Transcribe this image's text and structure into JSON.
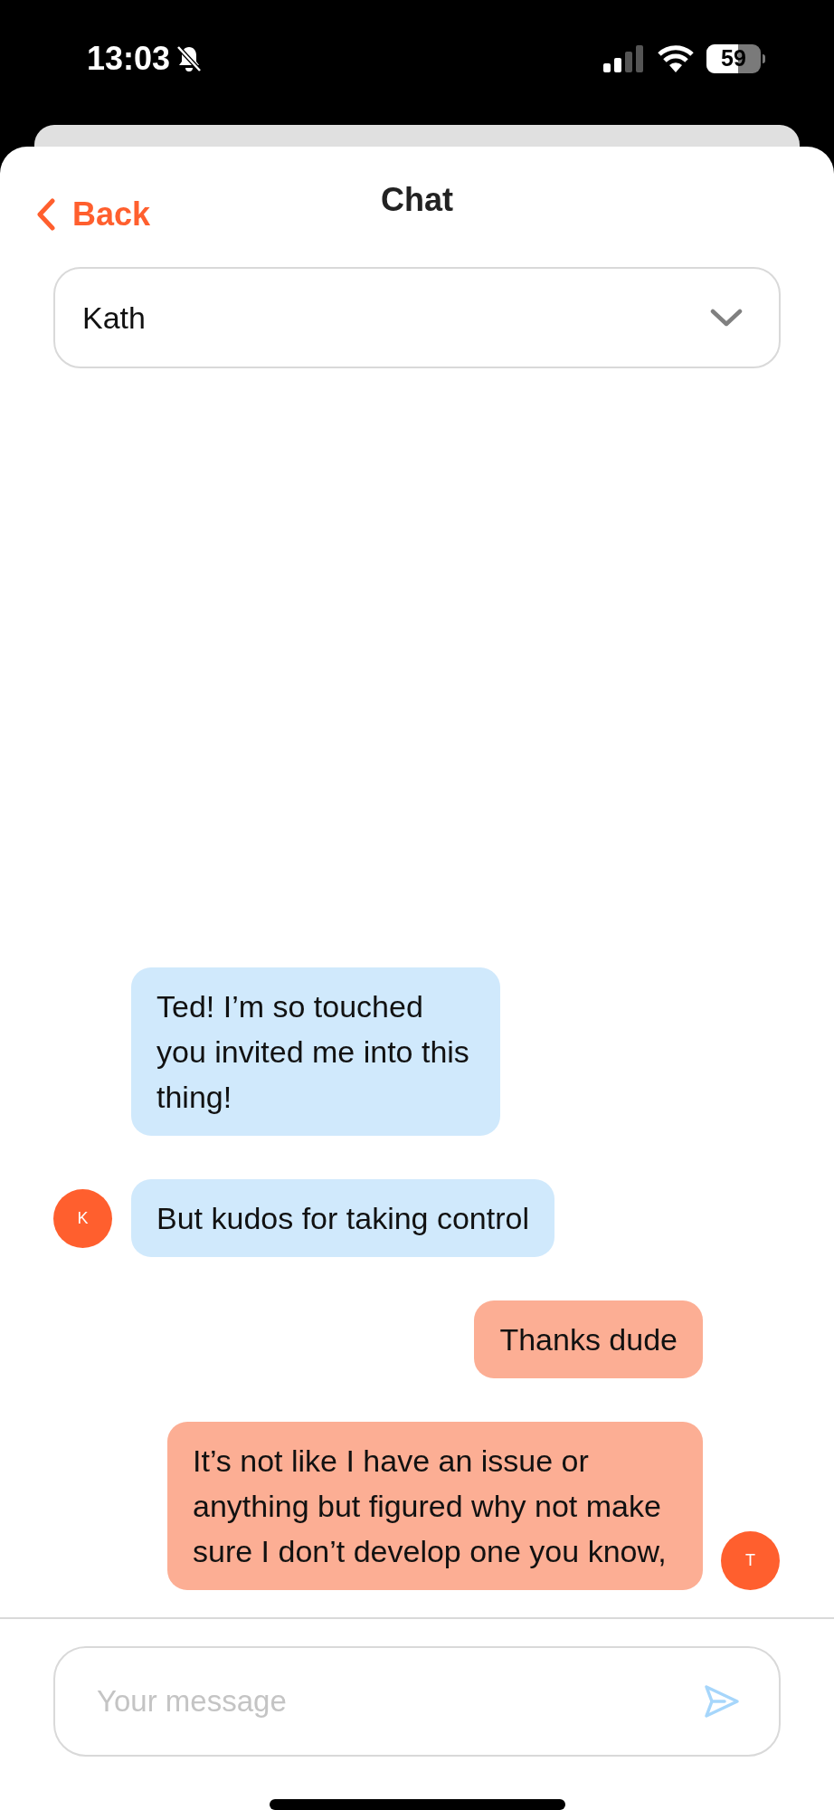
{
  "status_bar": {
    "time": "13:03",
    "battery": "59"
  },
  "header": {
    "back": "Back",
    "title": "Chat"
  },
  "recipient_select": {
    "value": "Kath"
  },
  "messages": [
    {
      "kind": "received",
      "text": "Ted! I’m so touched you invited me into this thing!"
    },
    {
      "kind": "received",
      "text": "But kudos for taking control",
      "avatar": "K"
    },
    {
      "kind": "sent",
      "text": "Thanks dude"
    },
    {
      "kind": "sent",
      "text": "It’s not like I have an issue or anything but figured why not make sure I don’t develop one you know,",
      "avatar": "T"
    }
  ],
  "composer": {
    "placeholder": "Your message"
  }
}
